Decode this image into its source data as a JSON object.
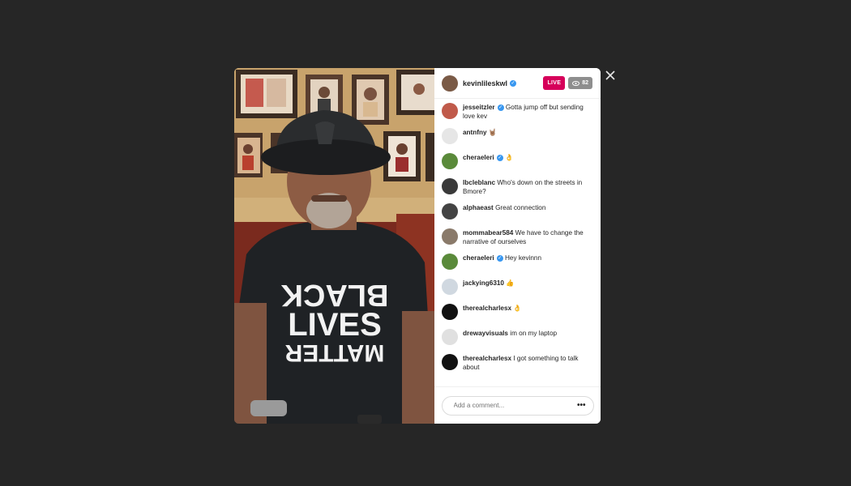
{
  "header": {
    "username": "kevinlileskwl",
    "live_label": "LIVE",
    "viewer_count": "82"
  },
  "comments": [
    {
      "user": "jesseitzler",
      "verified": true,
      "text": "Gotta jump off but sending love kev",
      "avatar_color": "#c05a4a"
    },
    {
      "user": "antnfny",
      "verified": false,
      "text": "🤘🏽",
      "avatar_color": "#e6e6e6"
    },
    {
      "user": "cheraeleri",
      "verified": true,
      "text": "👌",
      "avatar_color": "#5a8a3a"
    },
    {
      "user": "lbcleblanc",
      "verified": false,
      "text": "Who's down on the streets in Bmore?",
      "avatar_color": "#3a3a3a"
    },
    {
      "user": "alphaeast",
      "verified": false,
      "text": "Great connection",
      "avatar_color": "#444444"
    },
    {
      "user": "mommabear584",
      "verified": false,
      "text": "We have to change the narrative of ourselves",
      "avatar_color": "#8a7a6a"
    },
    {
      "user": "cheraeleri",
      "verified": true,
      "text": "Hey kevinnn",
      "avatar_color": "#5a8a3a"
    },
    {
      "user": "jackying6310",
      "verified": false,
      "text": "👍",
      "avatar_color": "#d0d8e0"
    },
    {
      "user": "therealcharlesx",
      "verified": false,
      "text": "👌",
      "avatar_color": "#111111"
    },
    {
      "user": "drewayvisuals",
      "verified": false,
      "text": "im on my laptop",
      "avatar_color": "#e0e0e0"
    },
    {
      "user": "therealcharlesx",
      "verified": false,
      "text": "I got something to talk about",
      "avatar_color": "#111111"
    }
  ],
  "composer": {
    "placeholder": "Add a comment...",
    "more_label": "•••"
  },
  "video": {
    "shirt_lines": [
      "BLACK",
      "LIVES",
      "MATTER"
    ]
  },
  "colors": {
    "backdrop": "#262626",
    "live_badge": "#d6005a",
    "verified": "#3897f0"
  }
}
